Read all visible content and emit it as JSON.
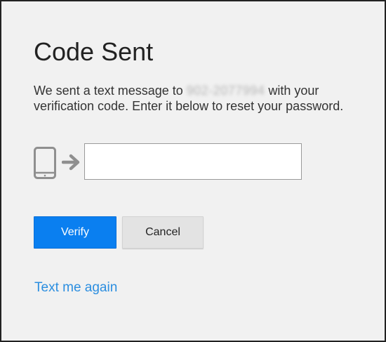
{
  "dialog": {
    "title": "Code Sent",
    "message": {
      "before": "We sent a text message to ",
      "phone_redacted": "902-2077994",
      "after": " with your verification code. Enter it below to reset your password."
    },
    "code_input": {
      "value": "",
      "placeholder": ""
    },
    "verify_label": "Verify",
    "cancel_label": "Cancel",
    "resend_link": "Text me again"
  },
  "icons": {
    "phone": "phone-icon",
    "arrow": "arrow-right-icon"
  },
  "colors": {
    "background": "#f1f1f1",
    "primary_button": "#0a7ff0",
    "secondary_button": "#e3e3e3",
    "link": "#2b8ee0",
    "icon": "#8f8f8f"
  }
}
